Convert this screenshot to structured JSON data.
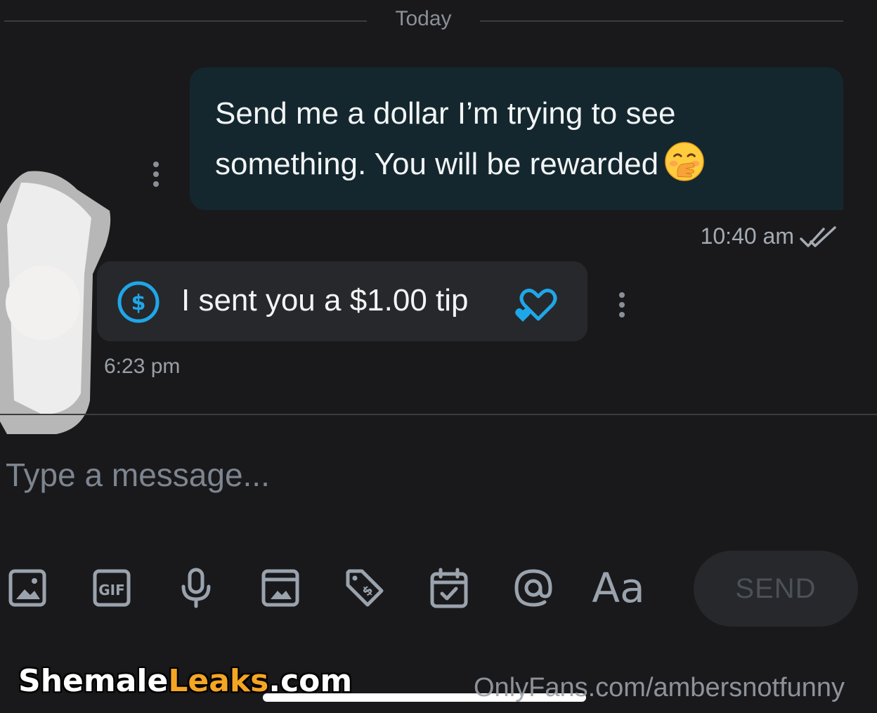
{
  "date_divider": {
    "label": "Today"
  },
  "messages": [
    {
      "direction": "outgoing",
      "text_line1": "Send me a dollar I’m trying to see",
      "text_line2": "something. You will be rewarded",
      "emoji": "hand-over-mouth-emoji",
      "time": "10:40 am",
      "status_icon": "double-check-icon"
    },
    {
      "direction": "incoming",
      "text": "I sent you a $1.00 tip",
      "icons": [
        "dollar-circle-icon",
        "two-hearts-icon"
      ],
      "time": "6:23 pm"
    }
  ],
  "composer": {
    "placeholder": "Type a message...",
    "tools": [
      "image-icon",
      "gif-icon",
      "microphone-icon",
      "vault-media-icon",
      "price-tag-icon",
      "calendar-icon",
      "mention-icon",
      "text-format-icon"
    ],
    "text_format_label": "Aa",
    "send_label": "SEND"
  },
  "watermarks": {
    "logo_part1": "Shemale",
    "logo_part2": "Leaks",
    "logo_part3": ".com",
    "source": "OnlyFans.com/ambersnotfunny"
  },
  "colors": {
    "background": "#19191b",
    "outgoing_bubble": "#14272f",
    "incoming_bubble": "#27282c",
    "accent_blue": "#1ea7e8",
    "muted_icon": "#9aa3ad"
  }
}
